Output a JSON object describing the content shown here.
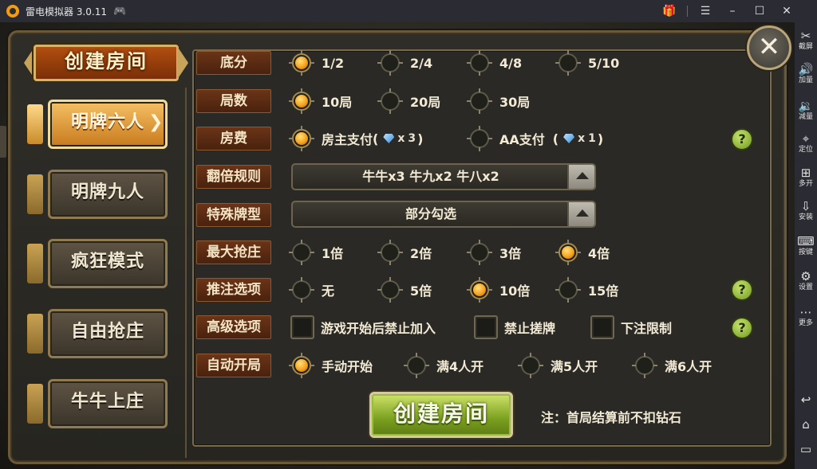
{
  "window": {
    "title": "雷电模拟器 3.0.11",
    "controls": [
      "gift-icon",
      "menu-icon",
      "minimize-icon",
      "maximize-icon",
      "close-icon"
    ]
  },
  "sidebar": {
    "items": [
      {
        "icon": "scissors-icon",
        "label": "截屏"
      },
      {
        "icon": "volume-up-icon",
        "label": "加量"
      },
      {
        "icon": "volume-down-icon",
        "label": "减量"
      },
      {
        "icon": "location-icon",
        "label": "定位"
      },
      {
        "icon": "multi-open-icon",
        "label": "多开"
      },
      {
        "icon": "apk-install-icon",
        "label": "安装"
      },
      {
        "icon": "keyboard-icon",
        "label": "按键"
      },
      {
        "icon": "settings-icon",
        "label": "设置"
      },
      {
        "icon": "more-icon",
        "label": "更多"
      }
    ],
    "nav": [
      "back-icon",
      "home-icon",
      "recent-apps-icon"
    ]
  },
  "dialog": {
    "header": "创建房间",
    "modes": [
      {
        "label": "明牌六人",
        "active": true
      },
      {
        "label": "明牌九人",
        "active": false
      },
      {
        "label": "疯狂模式",
        "active": false
      },
      {
        "label": "自由抢庄",
        "active": false
      },
      {
        "label": "牛牛上庄",
        "active": false
      }
    ],
    "rows": {
      "difen": {
        "label": "底分",
        "options": [
          "1/2",
          "2/4",
          "4/8",
          "5/10"
        ],
        "selected": 0
      },
      "jushu": {
        "label": "局数",
        "options": [
          "10局",
          "20局",
          "30局"
        ],
        "selected": 0
      },
      "fangfei": {
        "label": "房费",
        "options": [
          "房主支付",
          "AA支付"
        ],
        "counts": [
          "3",
          "1"
        ],
        "selected": 0
      },
      "fanbei": {
        "label": "翻倍规则",
        "value": "牛牛x3  牛九x2  牛八x2"
      },
      "teshu": {
        "label": "特殊牌型",
        "value": "部分勾选"
      },
      "qiangzhuang": {
        "label": "最大抢庄",
        "options": [
          "1倍",
          "2倍",
          "3倍",
          "4倍"
        ],
        "selected": 3
      },
      "tuizhu": {
        "label": "推注选项",
        "options": [
          "无",
          "5倍",
          "10倍",
          "15倍"
        ],
        "selected": 2
      },
      "gaoji": {
        "label": "高级选项",
        "options": [
          "游戏开始后禁止加入",
          "禁止搓牌",
          "下注限制"
        ]
      },
      "zidong": {
        "label": "自动开局",
        "options": [
          "手动开始",
          "满4人开",
          "满5人开",
          "满6人开"
        ],
        "selected": 0
      }
    },
    "help_label": "?",
    "create_button": "创建房间",
    "note": "注：首局结算前不扣钻石",
    "close_label": "✕",
    "gem_multiplier": "x"
  }
}
